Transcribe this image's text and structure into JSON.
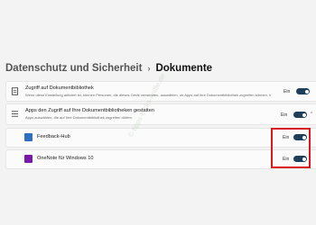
{
  "breadcrumb": {
    "parent": "Datenschutz und Sicherheit",
    "separator": "›",
    "current": "Dokumente"
  },
  "settings": [
    {
      "title": "Zugriff auf Dokumentbibliothek",
      "description": "Wenn diese Einstellung aktiviert ist, können Personen, die dieses Gerät verwenden, auswählen, ob Apps auf ihre Dokumentbibliothek zugreifen können. Wenn dies deaktiviert ist, kann keine Person auf die Dokumentbibliothek zugreifen.",
      "state": "Ein",
      "on": true,
      "icon": "document-icon"
    },
    {
      "title": "Apps den Zugriff auf Ihre Dokumentbibliotheken gestatten",
      "description": "Apps auswählen, die auf Ihre Dokumentbibliothek zugreifen dürfen.",
      "state": "Ein",
      "on": true,
      "icon": "list-icon",
      "expanded": true
    }
  ],
  "apps": [
    {
      "name": "Feedback-Hub",
      "state": "Ein",
      "on": true,
      "icon": "feedback-hub-icon",
      "color": "#2f6fc1"
    },
    {
      "name": "OneNote für Windows 10",
      "state": "Ein",
      "on": true,
      "icon": "onenote-icon",
      "color": "#7719aa"
    }
  ],
  "watermark": "© tipps-tricks-kniffe.de",
  "colors": {
    "accent": "#1e3f5c",
    "highlight": "#d9171e",
    "background": "#f3f3f3"
  }
}
